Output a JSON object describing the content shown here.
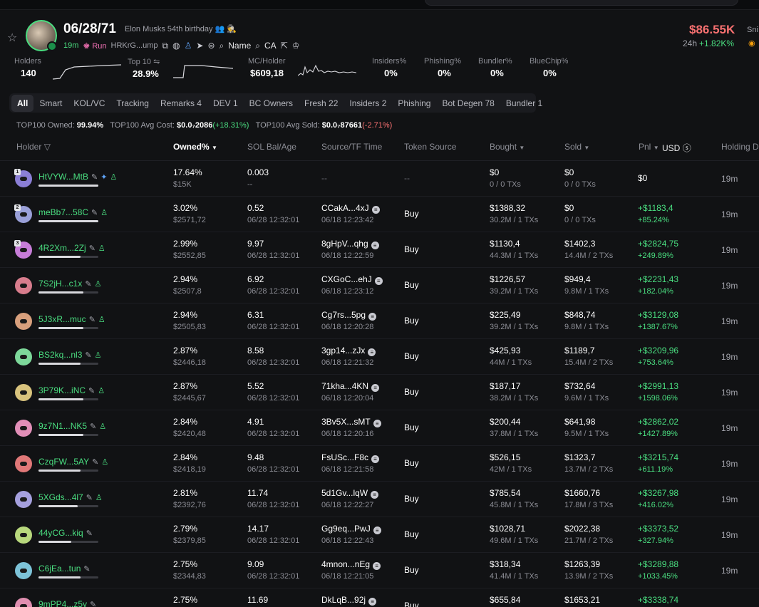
{
  "token": {
    "title": "06/28/71",
    "subtitle": "Elon Musks 54th birthday",
    "age": "19m",
    "run_label": "Run",
    "address": "HRKrG...ump",
    "name_label": "Name",
    "ca_label": "CA"
  },
  "price": {
    "value": "$86.55K",
    "period": "24h",
    "change": "+1.82K%",
    "extra_label": "Sni"
  },
  "stats": [
    {
      "label": "Holders",
      "value": "140"
    },
    {
      "label": "Top 10",
      "value": "28.9%"
    },
    {
      "label": "MC/Holder",
      "value": "$609,18"
    },
    {
      "label": "Insiders%",
      "value": "0%"
    },
    {
      "label": "Phishing%",
      "value": "0%"
    },
    {
      "label": "Bundler%",
      "value": "0%"
    },
    {
      "label": "BlueChip%",
      "value": "0%"
    }
  ],
  "tabs": [
    "All",
    "Smart",
    "KOL/VC",
    "Tracking",
    "Remarks 4",
    "DEV 1",
    "BC Owners",
    "Fresh 22",
    "Insiders 2",
    "Phishing",
    "Bot Degen 78",
    "Bundler 1"
  ],
  "summary": {
    "owned_label": "TOP100 Owned:",
    "owned_value": "99.94%",
    "avg_cost_label": "TOP100 Avg Cost:",
    "avg_cost_value": "$0.0₇2086",
    "avg_cost_change": "(+18.31%)",
    "avg_sold_label": "TOP100 Avg Sold:",
    "avg_sold_value": "$0.0₇87661",
    "avg_sold_change": "(-2.71%)"
  },
  "columns": {
    "holder": "Holder",
    "owned": "Owned%",
    "sol": "SOL Bal/Age",
    "source": "Source/TF Time",
    "token_source": "Token Source",
    "bought": "Bought",
    "sold": "Sold",
    "pnl": "Pnl",
    "currency": "USD",
    "holding": "Holding Du"
  },
  "holders": [
    {
      "addr": "HtVYW...MtB",
      "pct": "17.64%",
      "usd": "$15K",
      "sol": "0.003",
      "age": "--",
      "src": "--",
      "tf": "",
      "tsrc": "--",
      "b1": "$0",
      "b2": "0 / 0 TXs",
      "s1": "$0",
      "s2": "0 / 0 TXs",
      "p1": "$0",
      "p2": "",
      "hold": "19m",
      "fill": 1.0,
      "rank": "1",
      "color": "#8b7fd6"
    },
    {
      "addr": "meBb7...58C",
      "pct": "3.02%",
      "usd": "$2571,72",
      "sol": "0.52",
      "age": "06/28 12:32:01",
      "src": "CCakA...4xJ",
      "tf": "06/18 12:23:42",
      "tsrc": "Buy",
      "b1": "$1388,32",
      "b2": "30.2M / 1 TXs",
      "s1": "$0",
      "s2": "0 / 0 TXs",
      "p1": "+$1183,4",
      "p2": "+85.24%",
      "hold": "19m",
      "fill": 1.0,
      "rank": "2",
      "color": "#9aa0d8"
    },
    {
      "addr": "4R2Xm...2Zj",
      "pct": "2.99%",
      "usd": "$2552,85",
      "sol": "9.97",
      "age": "06/28 12:32:01",
      "src": "8gHpV...qhg",
      "tf": "06/18 12:22:59",
      "tsrc": "Buy",
      "b1": "$1130,4",
      "b2": "44.3M / 1 TXs",
      "s1": "$1402,3",
      "s2": "14.4M / 2 TXs",
      "p1": "+$2824,75",
      "p2": "+249.89%",
      "hold": "19m",
      "fill": 0.7,
      "rank": "3",
      "color": "#c77dd8"
    },
    {
      "addr": "7S2jH...c1x",
      "pct": "2.94%",
      "usd": "$2507,8",
      "sol": "6.92",
      "age": "06/28 12:32:01",
      "src": "CXGoC...ehJ",
      "tf": "06/18 12:23:12",
      "tsrc": "Buy",
      "b1": "$1226,57",
      "b2": "39.2M / 1 TXs",
      "s1": "$949,4",
      "s2": "9.8M / 1 TXs",
      "p1": "+$2231,43",
      "p2": "+182.04%",
      "hold": "19m",
      "fill": 0.75,
      "rank": "",
      "color": "#d87d8d"
    },
    {
      "addr": "5J3xR...muc",
      "pct": "2.94%",
      "usd": "$2505,83",
      "sol": "6.31",
      "age": "06/28 12:32:01",
      "src": "Cg7rs...5pg",
      "tf": "06/18 12:20:28",
      "tsrc": "Buy",
      "b1": "$225,49",
      "b2": "39.2M / 1 TXs",
      "s1": "$848,74",
      "s2": "9.8M / 1 TXs",
      "p1": "+$3129,08",
      "p2": "+1387.67%",
      "hold": "19m",
      "fill": 0.75,
      "rank": "",
      "color": "#d8a07d"
    },
    {
      "addr": "BS2kq...nl3",
      "pct": "2.87%",
      "usd": "$2446,18",
      "sol": "8.58",
      "age": "06/28 12:32:01",
      "src": "3gp14...zJx",
      "tf": "06/18 12:21:32",
      "tsrc": "Buy",
      "b1": "$425,93",
      "b2": "44M / 1 TXs",
      "s1": "$1189,7",
      "s2": "15.4M / 2 TXs",
      "p1": "+$3209,96",
      "p2": "+753.64%",
      "hold": "19m",
      "fill": 0.7,
      "rank": "",
      "color": "#7dd89a"
    },
    {
      "addr": "3P79K...iNC",
      "pct": "2.87%",
      "usd": "$2445,67",
      "sol": "5.52",
      "age": "06/28 12:32:01",
      "src": "71kha...4KN",
      "tf": "06/18 12:20:04",
      "tsrc": "Buy",
      "b1": "$187,17",
      "b2": "38.2M / 1 TXs",
      "s1": "$732,64",
      "s2": "9.6M / 1 TXs",
      "p1": "+$2991,13",
      "p2": "+1598.06%",
      "hold": "19m",
      "fill": 0.75,
      "rank": "",
      "color": "#d8c37d"
    },
    {
      "addr": "9z7N1...NK5",
      "pct": "2.84%",
      "usd": "$2420,48",
      "sol": "4.91",
      "age": "06/28 12:32:01",
      "src": "3Bv5X...sMT",
      "tf": "06/18 12:20:16",
      "tsrc": "Buy",
      "b1": "$200,44",
      "b2": "37.8M / 1 TXs",
      "s1": "$641,98",
      "s2": "9.5M / 1 TXs",
      "p1": "+$2862,02",
      "p2": "+1427.89%",
      "hold": "19m",
      "fill": 0.75,
      "rank": "",
      "color": "#e28fb8"
    },
    {
      "addr": "CzqFW...5AY",
      "pct": "2.84%",
      "usd": "$2418,19",
      "sol": "9.48",
      "age": "06/28 12:32:01",
      "src": "FsUSc...F8c",
      "tf": "06/18 12:21:58",
      "tsrc": "Buy",
      "b1": "$526,15",
      "b2": "42M / 1 TXs",
      "s1": "$1323,7",
      "s2": "13.7M / 2 TXs",
      "p1": "+$3215,74",
      "p2": "+611.19%",
      "hold": "19m",
      "fill": 0.7,
      "rank": "",
      "color": "#e07878"
    },
    {
      "addr": "5XGds...4l7",
      "pct": "2.81%",
      "usd": "$2392,76",
      "sol": "11.74",
      "age": "06/28 12:32:01",
      "src": "5d1Gv...lqW",
      "tf": "06/18 12:22:27",
      "tsrc": "Buy",
      "b1": "$785,54",
      "b2": "45.8M / 1 TXs",
      "s1": "$1660,76",
      "s2": "17.8M / 3 TXs",
      "p1": "+$3267,98",
      "p2": "+416.02%",
      "hold": "19m",
      "fill": 0.65,
      "rank": "",
      "color": "#a5a0de"
    },
    {
      "addr": "44yCG...kiq",
      "pct": "2.79%",
      "usd": "$2379,85",
      "sol": "14.17",
      "age": "06/28 12:32:01",
      "src": "Gg9eq...PwJ",
      "tf": "06/18 12:22:43",
      "tsrc": "Buy",
      "b1": "$1028,71",
      "b2": "49.6M / 1 TXs",
      "s1": "$2022,38",
      "s2": "21.7M / 2 TXs",
      "p1": "+$3373,52",
      "p2": "+327.94%",
      "hold": "19m",
      "fill": 0.55,
      "rank": "",
      "color": "#b8d87d"
    },
    {
      "addr": "C6jEa...tun",
      "pct": "2.75%",
      "usd": "$2344,83",
      "sol": "9.09",
      "age": "06/28 12:32:01",
      "src": "4mnon...nEg",
      "tf": "06/18 12:21:05",
      "tsrc": "Buy",
      "b1": "$318,34",
      "b2": "41.4M / 1 TXs",
      "s1": "$1263,39",
      "s2": "13.9M / 2 TXs",
      "p1": "+$3289,88",
      "p2": "+1033.45%",
      "hold": "19m",
      "fill": 0.7,
      "rank": "",
      "color": "#7dc3d8"
    },
    {
      "addr": "9mPP4...z5y",
      "pct": "2.75%",
      "usd": "",
      "sol": "11.69",
      "age": "",
      "src": "DkLqB...92j",
      "tf": "",
      "tsrc": "Buy",
      "b1": "$655,84",
      "b2": "",
      "s1": "$1653,21",
      "s2": "",
      "p1": "+$3338,74",
      "p2": "",
      "hold": "",
      "fill": 0.6,
      "rank": "",
      "color": "#e08fb0"
    }
  ]
}
